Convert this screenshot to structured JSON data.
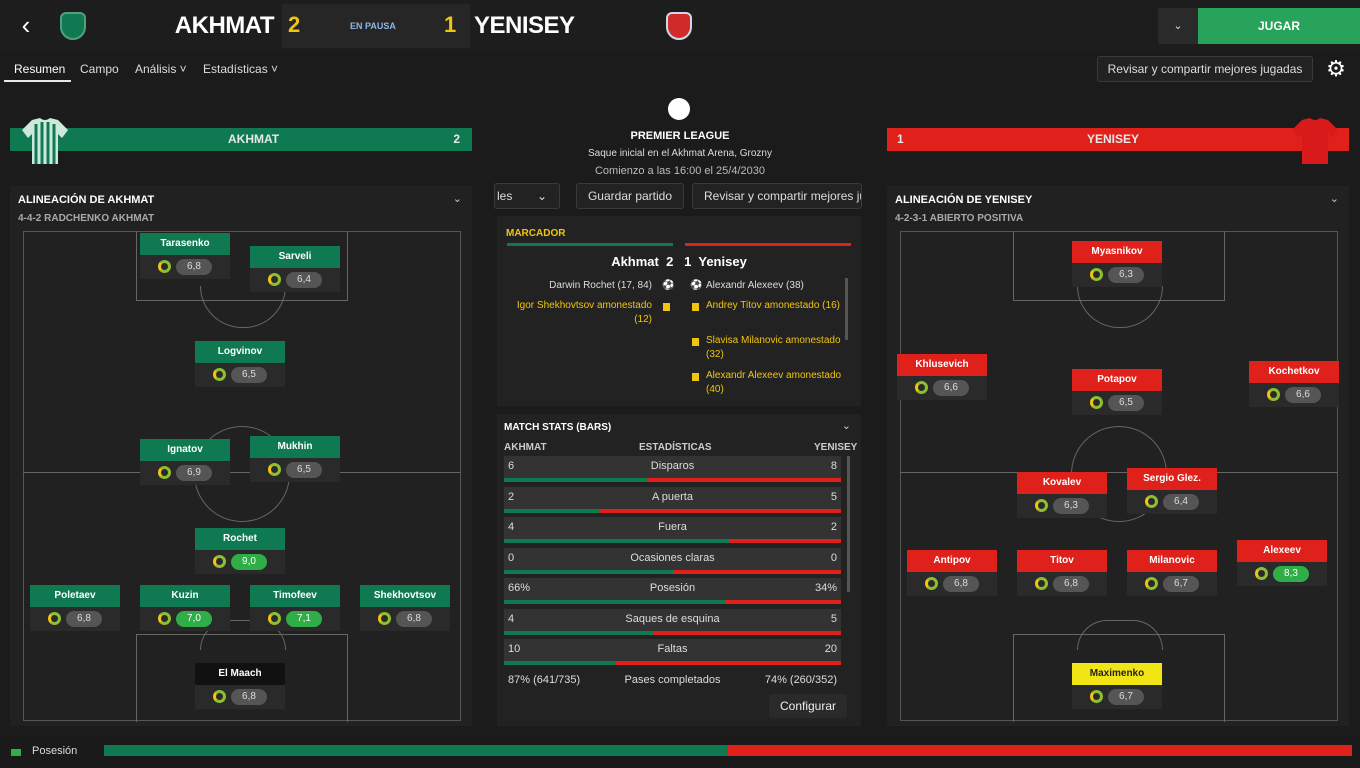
{
  "header": {
    "back_icon": "chevron-left-icon",
    "home_team": "AKHMAT",
    "home_goals": "2",
    "status": "EN PAUSA",
    "away_goals": "1",
    "away_team": "YENISEY",
    "play_label": "JUGAR",
    "dropdown_icon": "chevron-down-icon"
  },
  "nav": {
    "tabs": [
      "Resumen",
      "Campo",
      "Análisis ˅",
      "Estadísticas ˅"
    ],
    "share_label": "Revisar y compartir mejores jugadas",
    "gear_icon": "gear-icon"
  },
  "banners": {
    "home_name": "AKHMAT",
    "home_goals": "2",
    "away_goals": "1",
    "away_name": "YENISEY"
  },
  "home_lineup": {
    "title": "ALINEACIÓN DE AKHMAT",
    "formation": "4-4-2 RADCHENKO AKHMAT",
    "players": [
      {
        "name": "Tarasenko",
        "rating": "6,8"
      },
      {
        "name": "Sarveli",
        "rating": "6,4"
      },
      {
        "name": "Logvinov",
        "rating": "6,5"
      },
      {
        "name": "Ignatov",
        "rating": "6,9"
      },
      {
        "name": "Mukhin",
        "rating": "6,5"
      },
      {
        "name": "Rochet",
        "rating": "9,0"
      },
      {
        "name": "Poletaev",
        "rating": "6,8"
      },
      {
        "name": "Kuzin",
        "rating": "7,0"
      },
      {
        "name": "Timofeev",
        "rating": "7,1"
      },
      {
        "name": "Shekhovtsov",
        "rating": "6,8"
      },
      {
        "name": "El Maach",
        "rating": "6,8"
      }
    ]
  },
  "away_lineup": {
    "title": "ALINEACIÓN DE YENISEY",
    "formation": "4-2-3-1 ABIERTO POSITIVA",
    "players": [
      {
        "name": "Myasnikov",
        "rating": "6,3"
      },
      {
        "name": "Khlusevich",
        "rating": "6,6"
      },
      {
        "name": "Potapov",
        "rating": "6,5"
      },
      {
        "name": "Kochetkov",
        "rating": "6,6"
      },
      {
        "name": "Kovalev",
        "rating": "6,3"
      },
      {
        "name": "Sergio Glez.",
        "rating": "6,4"
      },
      {
        "name": "Antipov",
        "rating": "6,8"
      },
      {
        "name": "Titov",
        "rating": "6,8"
      },
      {
        "name": "Milanovic",
        "rating": "6,7"
      },
      {
        "name": "Alexeev",
        "rating": "8,3"
      },
      {
        "name": "Maximenko",
        "rating": "6,7"
      }
    ]
  },
  "center": {
    "league": "PREMIER LEAGUE",
    "venue": "Saque inicial en el Akhmat Arena, Grozny",
    "time": "Comienzo a las 16:00 el 25/4/2030",
    "btn_partial": "les",
    "btn_save": "Guardar partido",
    "btn_share": "Revisar y compartir mejores ju"
  },
  "marcador": {
    "title": "MARCADOR",
    "score_line": "Akhmat  2   1  Yenisey",
    "home_events": [
      "Darwin Rochet (17, 84)",
      "Igor Shekhovtsov amonestado (12)"
    ],
    "away_events": [
      "Alexandr Alexeev (38)",
      "Andrey Titov amonestado (16)",
      "Slavisa Milanovic amonestado (32)",
      "Alexandr Alexeev amonestado (40)"
    ]
  },
  "stats": {
    "title": "MATCH STATS (BARS)",
    "home_header": "AKHMAT",
    "center_header": "ESTADÍSTICAS",
    "away_header": "YENISEY",
    "rows": [
      {
        "label": "Disparos",
        "home": "6",
        "away": "8",
        "h": 6,
        "a": 8
      },
      {
        "label": "A puerta",
        "home": "2",
        "away": "5",
        "h": 2,
        "a": 5
      },
      {
        "label": "Fuera",
        "home": "4",
        "away": "2",
        "h": 4,
        "a": 2
      },
      {
        "label": "Ocasiones claras",
        "home": "0",
        "away": "0",
        "h": 1,
        "a": 1
      },
      {
        "label": "Posesión",
        "home": "66%",
        "away": "34%",
        "h": 66,
        "a": 34
      },
      {
        "label": "Saques de esquina",
        "home": "4",
        "away": "5",
        "h": 4,
        "a": 5
      },
      {
        "label": "Faltas",
        "home": "10",
        "away": "20",
        "h": 10,
        "a": 20
      },
      {
        "label": "Pases completados",
        "home": "87% (641/735)",
        "away": "74% (260/352)",
        "h": 0,
        "a": 0
      }
    ],
    "configure": "Configurar"
  },
  "possession_bar": {
    "label": "Posesión",
    "home_fraction": 0.5
  },
  "colors": {
    "home": "#0f7a52",
    "away": "#e0201a",
    "accent": "#27a35b",
    "gold": "#f1c40f"
  }
}
